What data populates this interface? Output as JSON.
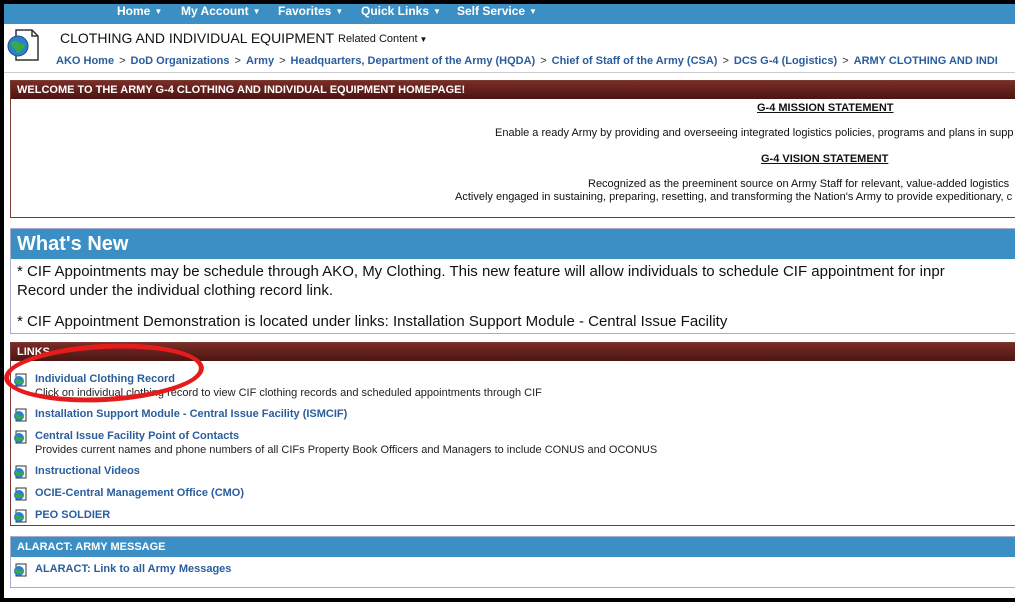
{
  "nav": {
    "items": [
      {
        "label": "Home"
      },
      {
        "label": "My Account"
      },
      {
        "label": "Favorites"
      },
      {
        "label": "Quick Links"
      },
      {
        "label": "Self Service"
      }
    ],
    "caret": "▼"
  },
  "header": {
    "site_title": "CLOTHING AND INDIVIDUAL EQUIPMENT",
    "related_content": "Related Content",
    "caret": "▼",
    "icon": "globe-document-icon",
    "breadcrumb": [
      "AKO Home",
      "DoD Organizations",
      "Army",
      "Headquarters, Department of the Army (HQDA)",
      "Chief of Staff of the Army (CSA)",
      "DCS G-4 (Logistics)",
      "ARMY CLOTHING AND INDI"
    ],
    "breadcrumb_sep": ">"
  },
  "welcome": {
    "title": "WELCOME TO THE ARMY G-4 CLOTHING AND INDIVIDUAL EQUIPMENT HOMEPAGE!",
    "mission_heading": "G-4 MISSION STATEMENT",
    "mission_text": "Enable a ready Army by providing and overseeing integrated logistics policies, programs and plans in supp",
    "vision_heading": "G-4 VISION STATEMENT",
    "vision_text_1": "Recognized as the preeminent source on Army Staff for relevant, value-added logistics",
    "vision_text_2": "Actively engaged in sustaining, preparing, resetting, and transforming the Nation's Army to provide expeditionary, c"
  },
  "whats_new": {
    "title": "What's New",
    "line1": "*  CIF Appointments may be schedule through AKO, My Clothing.  This new feature will allow individuals to schedule CIF appointment for inpr",
    "line2": "Record under the individual clothing record link.",
    "line3": "*  CIF Appointment Demonstration is located under links:  Installation Support Module - Central Issue Facility"
  },
  "links": {
    "title": "LINKS",
    "items": [
      {
        "title": "Individual Clothing Record",
        "desc": "Click on individual clothing record to view CIF clothing records and scheduled appointments through CIF"
      },
      {
        "title": "Installation Support Module - Central Issue Facility (ISMCIF)",
        "desc": ""
      },
      {
        "title": "Central Issue Facility Point of Contacts",
        "desc": "Provides current names and phone numbers of all CIFs Property Book Officers and Managers to include CONUS and OCONUS"
      },
      {
        "title": "Instructional Videos",
        "desc": ""
      },
      {
        "title": "OCIE-Central Management Office (CMO)",
        "desc": ""
      },
      {
        "title": "PEO SOLDIER",
        "desc": ""
      }
    ]
  },
  "alaract": {
    "title": "ALARACT: ARMY MESSAGE",
    "link": "ALARACT: Link to all Army Messages"
  },
  "colors": {
    "nav_blue": "#3b8fc4",
    "maroon": "#5a1c18",
    "link_blue": "#2a5d9e",
    "annotation_red": "#e51c1c"
  }
}
